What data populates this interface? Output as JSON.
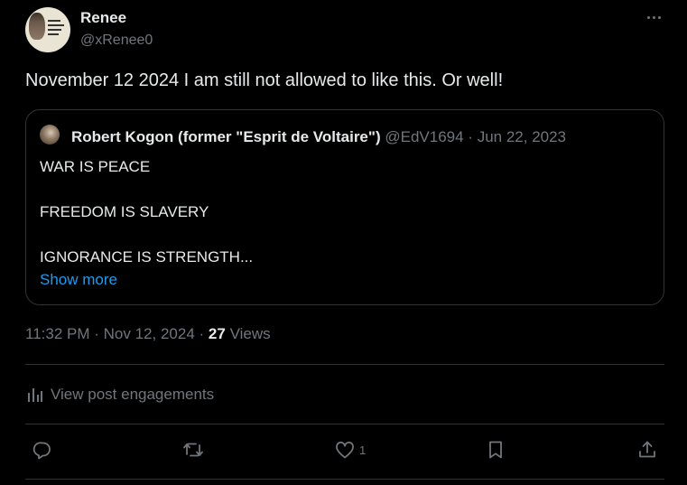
{
  "author": {
    "name": "Renee",
    "handle": "@xRenee0"
  },
  "post": {
    "text": "November 12 2024 I am still not allowed to like this. Or well!",
    "time": "11:32 PM",
    "date": "Nov 12, 2024",
    "views_count": "27",
    "views_label": "Views"
  },
  "quoted_post": {
    "name": "Robert Kogon (former \"Esprit de Voltaire\")",
    "handle": "@EdV1694",
    "date": "Jun 22, 2023",
    "lines": [
      "WAR IS PEACE",
      "FREEDOM IS SLAVERY",
      "IGNORANCE IS STRENGTH..."
    ],
    "show_more": "Show more"
  },
  "engagements_label": "View post engagements",
  "actions": {
    "like_count": "1"
  },
  "icons": {
    "more": "more-icon",
    "engagements": "bar-chart-icon",
    "reply": "reply-icon",
    "repost": "repost-icon",
    "like": "heart-icon",
    "bookmark": "bookmark-icon",
    "share": "share-icon"
  },
  "colors": {
    "background": "#000000",
    "text": "#e7e9ea",
    "secondary_text": "#71767b",
    "link": "#1d9bf0",
    "border": "#2f3336"
  }
}
